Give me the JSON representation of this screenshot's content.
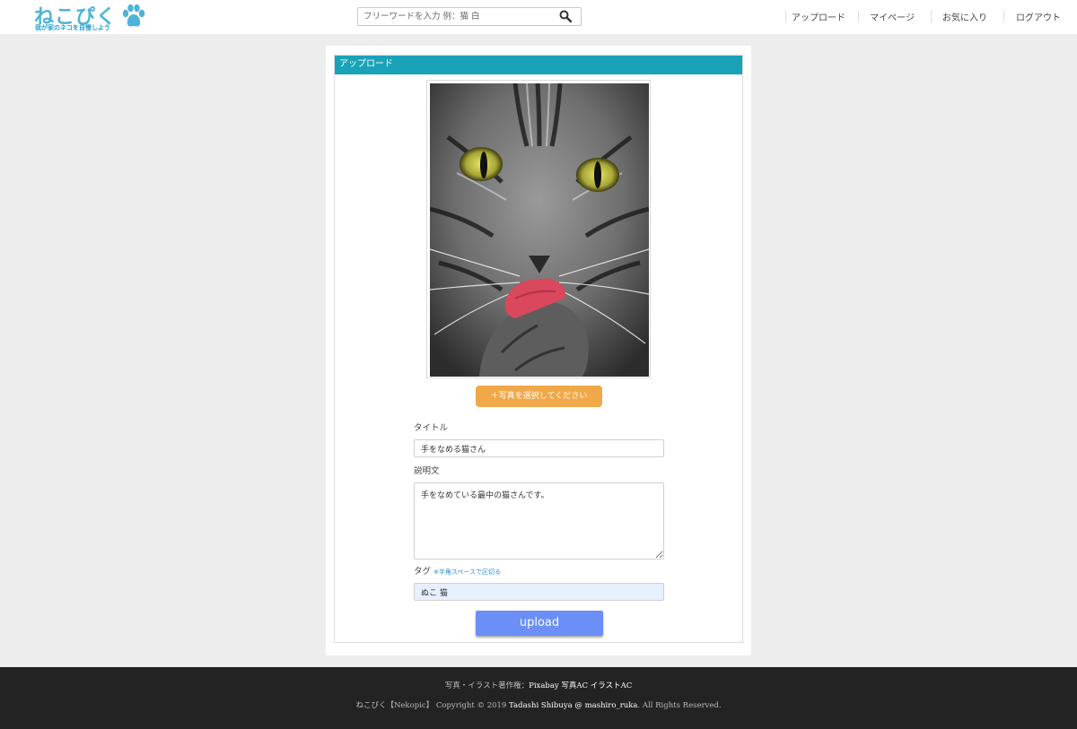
{
  "header": {
    "logo": {
      "text": "ねこぴく",
      "tagline": "我が家のネコを自慢しよう"
    },
    "search": {
      "placeholder": "フリーワードを入力 例：猫 白"
    },
    "nav": [
      {
        "label": "アップロード"
      },
      {
        "label": "マイページ"
      },
      {
        "label": "お気に入り"
      },
      {
        "label": "ログアウト"
      }
    ]
  },
  "panel": {
    "title": "アップロード",
    "select_photo_label": "＋写真を選択してください",
    "title_label": "タイトル",
    "title_value": "手をなめる猫さん",
    "description_label": "説明文",
    "description_value": "手をなめている最中の猫さんです。",
    "tag_label": "タグ",
    "tag_note": "※半角スペースで区切る",
    "tag_value": "ぬこ 猫",
    "upload_label": "upload"
  },
  "footer": {
    "credits_prefix": "写真・イラスト著作権：",
    "credits_links": "Pixabay 写真AC イラストAC",
    "copyright_prefix": "ねこぴく【Nekopic】 Copyright © 2019 ",
    "copyright_author": "Tadashi Shibuya @ mashiro_ruka",
    "copyright_suffix": ". All Rights Reserved."
  },
  "colors": {
    "brand": "#4fb3d9",
    "panel_header": "#1aa3b8",
    "select_button": "#f0a848",
    "upload_button": "#6b8ff7",
    "footer_bg": "#232323",
    "page_bg": "#ededed"
  },
  "icons": {
    "logo": "paw-print-icon",
    "search": "magnifier-icon"
  }
}
